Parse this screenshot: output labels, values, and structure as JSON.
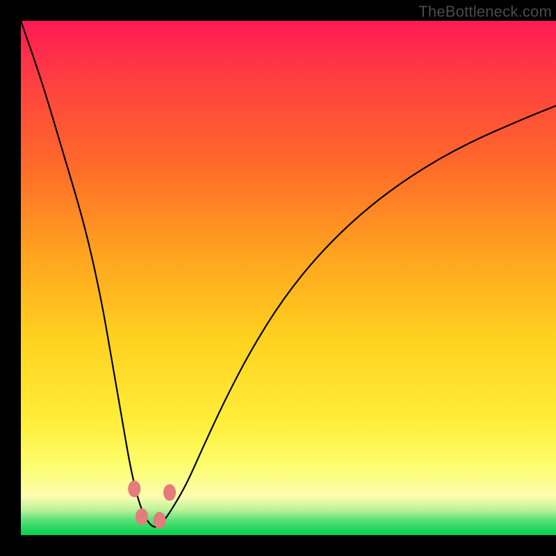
{
  "watermark": "TheBottleneck.com",
  "colors": {
    "curve": "#000000",
    "dot": "#e57b7b",
    "frame_bg": "#000000"
  },
  "chart_data": {
    "type": "line",
    "title": "",
    "xlabel": "",
    "ylabel": "",
    "xlim": [
      0,
      100
    ],
    "ylim": [
      0,
      100
    ],
    "note": "Axes are unlabeled; values are estimated pixel-relative percentages of the plot area.",
    "series": [
      {
        "name": "bottleneck-curve",
        "x": [
          0,
          4,
          8,
          12,
          15,
          17,
          19,
          20.5,
          22,
          23.5,
          25,
          26.5,
          28.5,
          31,
          34,
          38,
          43,
          49,
          56,
          64,
          73,
          83,
          94,
          100
        ],
        "y": [
          100,
          88,
          74,
          60,
          46,
          34,
          22,
          13,
          6.5,
          2.8,
          1.3,
          2.4,
          5.5,
          10,
          17,
          26,
          36,
          46,
          55,
          63,
          70,
          76,
          81,
          83.5
        ]
      }
    ],
    "markers": [
      {
        "x": 21.2,
        "y": 9.0
      },
      {
        "x": 22.6,
        "y": 3.6
      },
      {
        "x": 25.9,
        "y": 2.9
      },
      {
        "x": 27.8,
        "y": 8.3
      }
    ],
    "background_gradient_stops": [
      {
        "pos": 0.0,
        "color": "#ff1a55"
      },
      {
        "pos": 0.28,
        "color": "#ff6a2a"
      },
      {
        "pos": 0.62,
        "color": "#ffd21f"
      },
      {
        "pos": 0.88,
        "color": "#fdfd80"
      },
      {
        "pos": 0.97,
        "color": "#5ee27a"
      },
      {
        "pos": 1.0,
        "color": "#0bcf52"
      }
    ]
  }
}
